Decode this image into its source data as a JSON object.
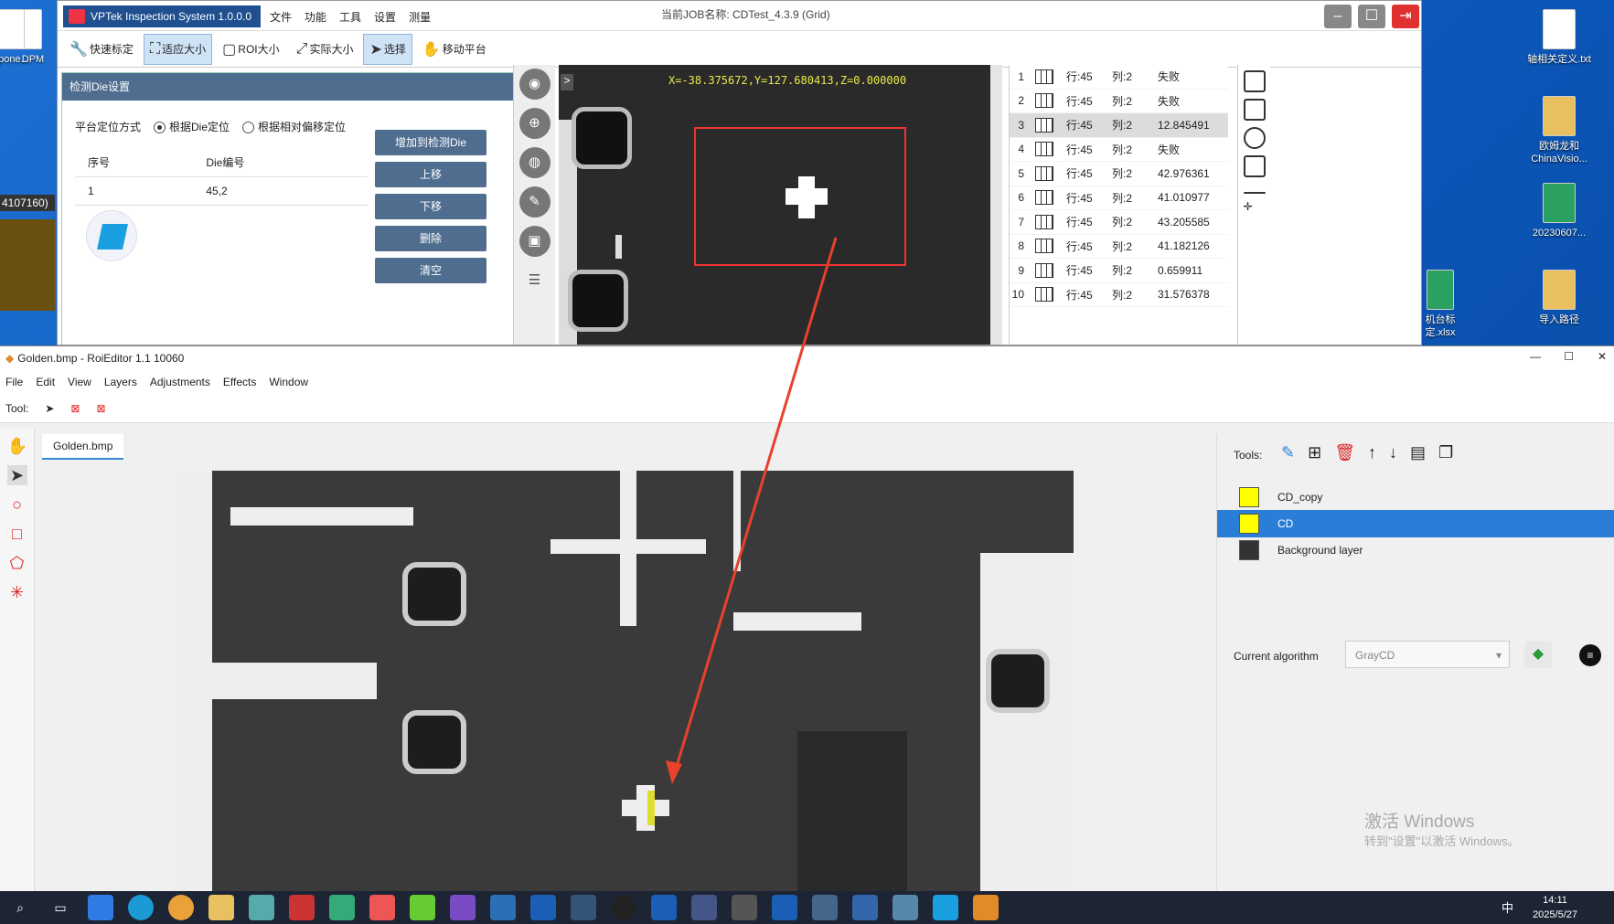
{
  "desktop": {
    "icons_left": [
      "pone...",
      "DPM"
    ],
    "side_text": "4107160)",
    "icons_right": [
      {
        "label": "轴相关定义.txt"
      },
      {
        "label": "欧姆龙和ChinaVisio..."
      },
      {
        "label": "20230607..."
      },
      {
        "label": "导入路径"
      },
      {
        "label": "机台标定.xlsx"
      }
    ]
  },
  "vptek": {
    "title": "VPTek Inspection System 1.0.0.0",
    "menu": [
      "文件",
      "功能",
      "工具",
      "设置",
      "测量"
    ],
    "job_label": "当前JOB名称: CDTest_4.3.9 (Grid)",
    "toolbar": [
      "快速标定",
      "适应大小",
      "ROI大小",
      "实际大小",
      "选择",
      "移动平台"
    ],
    "panel": {
      "title": "检测Die设置",
      "position_mode_label": "平台定位方式",
      "radio1": "根据Die定位",
      "radio2": "根据相对偏移定位",
      "col_index": "序号",
      "col_die": "Die编号",
      "rows": [
        {
          "idx": "1",
          "die": "45,2"
        }
      ],
      "buttons": [
        "增加到检测Die",
        "上移",
        "下移",
        "删除",
        "清空"
      ]
    },
    "camera": {
      "coords": "X=-38.375672,Y=127.680413,Z=0.000000",
      "expand_label": ">"
    },
    "results": [
      {
        "n": "1",
        "row": "行:45",
        "col": "列:2",
        "val": "失败"
      },
      {
        "n": "2",
        "row": "行:45",
        "col": "列:2",
        "val": "失败"
      },
      {
        "n": "3",
        "row": "行:45",
        "col": "列:2",
        "val": "12.845491"
      },
      {
        "n": "4",
        "row": "行:45",
        "col": "列:2",
        "val": "失败"
      },
      {
        "n": "5",
        "row": "行:45",
        "col": "列:2",
        "val": "42.976361"
      },
      {
        "n": "6",
        "row": "行:45",
        "col": "列:2",
        "val": "41.010977"
      },
      {
        "n": "7",
        "row": "行:45",
        "col": "列:2",
        "val": "43.205585"
      },
      {
        "n": "8",
        "row": "行:45",
        "col": "列:2",
        "val": "41.182126"
      },
      {
        "n": "9",
        "row": "行:45",
        "col": "列:2",
        "val": "0.659911"
      },
      {
        "n": "10",
        "row": "行:45",
        "col": "列:2",
        "val": "31.576378"
      }
    ],
    "selected_result": 2
  },
  "roi": {
    "title": "Golden.bmp - RoiEditor 1.1 10060",
    "menu": [
      "File",
      "Edit",
      "View",
      "Layers",
      "Adjustments",
      "Effects",
      "Window"
    ],
    "tool_label": "Tool:",
    "doc_tab": "Golden.bmp",
    "tools_label": "Tools:",
    "layers": [
      {
        "name": "CD_copy",
        "color": "#ffff00"
      },
      {
        "name": "CD",
        "color": "#ffff00"
      },
      {
        "name": "Background layer",
        "color": "#333333"
      }
    ],
    "selected_layer": 1,
    "algo_label": "Current algorithm",
    "algo_value": "GrayCD",
    "watermark": "激活 Windows",
    "watermark_sub": "转到\"设置\"以激活 Windows。"
  },
  "taskbar": {
    "time": "14:11",
    "date": "2025/5/27",
    "ime": "中"
  },
  "colors": {
    "accent": "#2b7ed8",
    "vp_header": "#4f6d8f",
    "roi_red": "#e33333"
  }
}
